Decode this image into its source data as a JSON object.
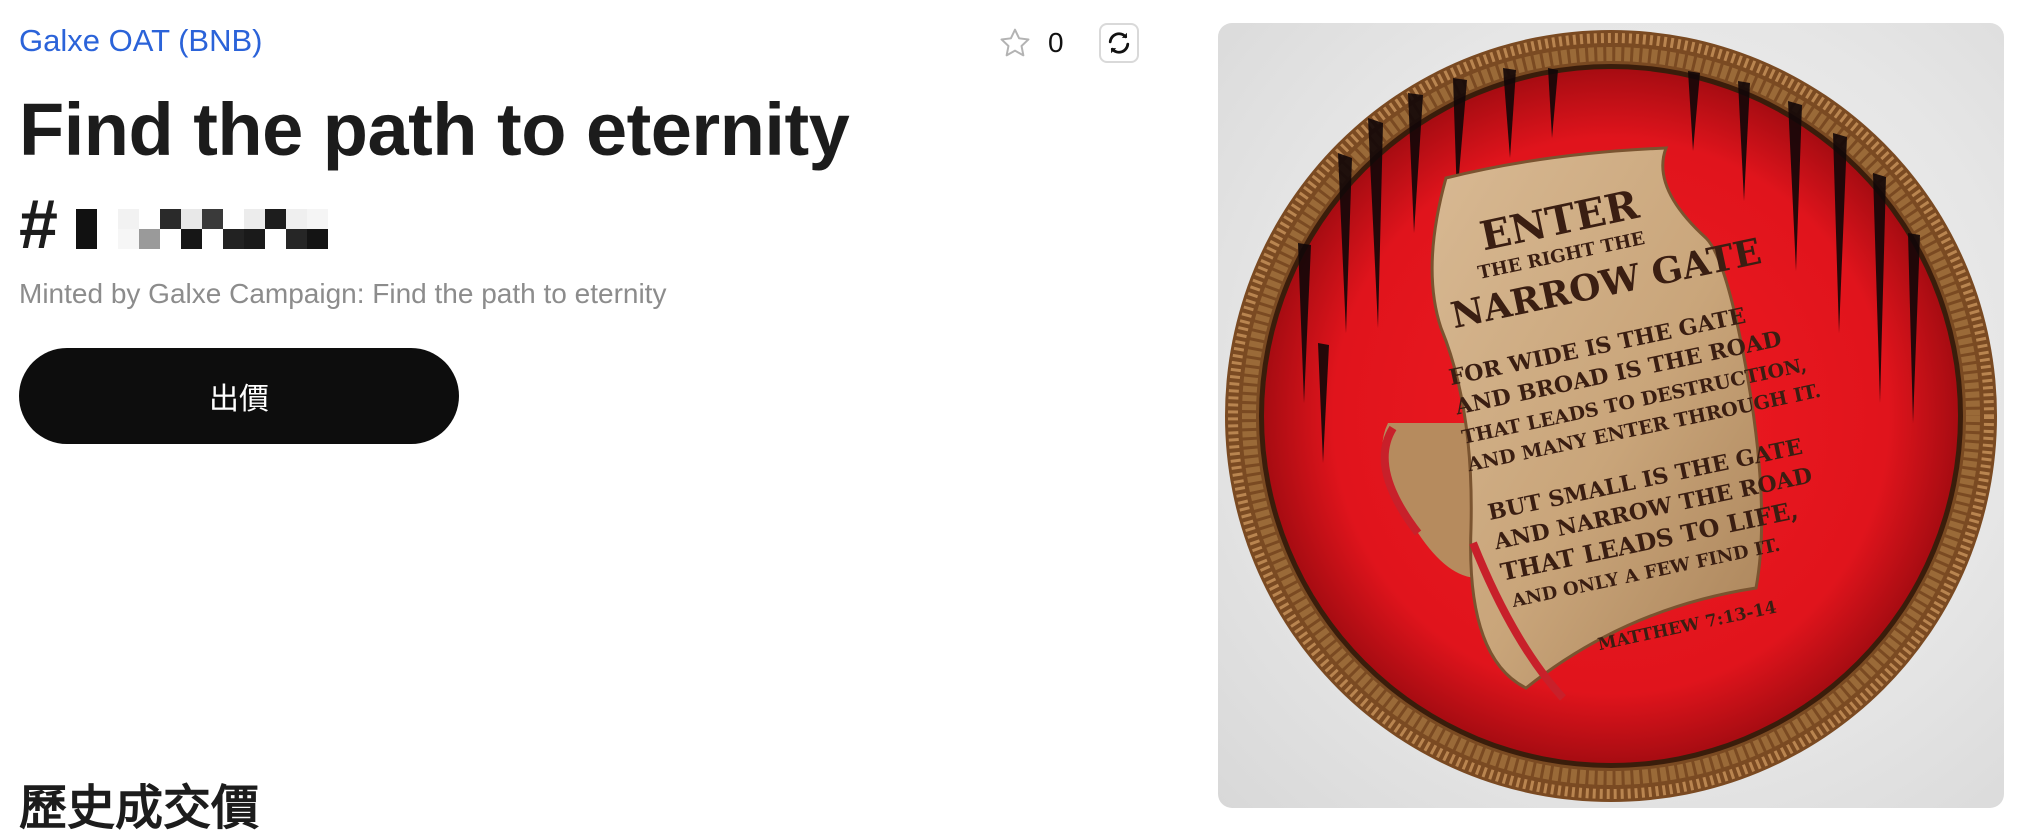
{
  "header": {
    "collection_name": "Galxe OAT (BNB)",
    "favorites_count": "0"
  },
  "nft": {
    "title": "Find the path to eternity",
    "token_hash": "#",
    "minted_by": "Minted by Galxe Campaign: Find the path to eternity"
  },
  "actions": {
    "offer_label": "出價"
  },
  "sections": {
    "price_history_heading": "歷史成交價"
  },
  "artwork": {
    "scroll_lines": [
      "ENTER",
      "THE RIGHT THE",
      "NARROW GATE",
      "FOR WIDE IS THE GATE",
      "AND BROAD IS THE ROAD",
      "THAT LEADS TO DESTRUCTION,",
      "AND MANY ENTER THROUGH IT.",
      "BUT SMALL IS THE GATE",
      "AND NARROW THE ROAD",
      "THAT LEADS TO LIFE,",
      "AND ONLY A FEW FIND IT.",
      "MATTHEW 7:13-14"
    ]
  },
  "icons": {
    "favorite": "star-icon",
    "refresh": "refresh-icon"
  },
  "colors": {
    "link": "#2b63d9",
    "button_bg": "#0d0d0d",
    "muted_text": "#8c8c8c",
    "art_red": "#e01b24",
    "art_frame": "#8a5a2b"
  }
}
